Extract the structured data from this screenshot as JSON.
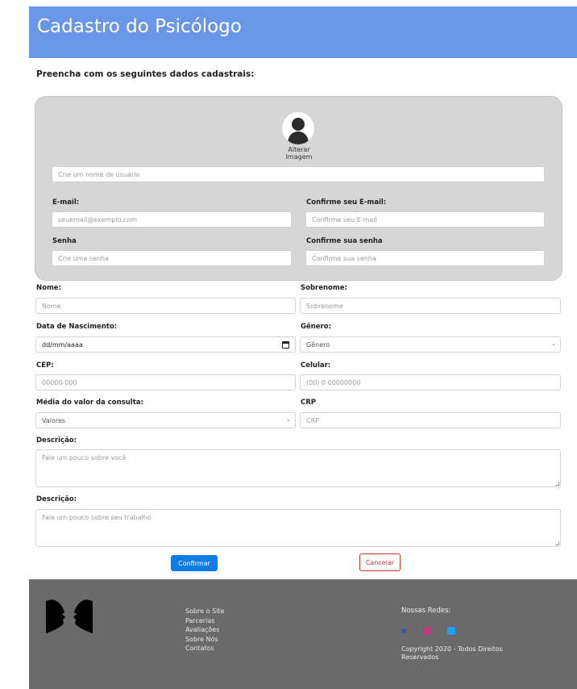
{
  "header": {
    "title": "Cadastro do Psicólogo"
  },
  "intro": "Preencha com os seguintes dados cadastrais:",
  "account": {
    "change_image_label": "Alterar Imagem",
    "username_placeholder": "Crie um nome de usuário",
    "email_label": "E-mail:",
    "email_placeholder": "seuemail@exemplo.com",
    "confirm_email_label": "Confirme seu E-mail:",
    "confirm_email_placeholder": "Confirme seu E-mail",
    "password_label": "Senha",
    "password_placeholder": "Crie uma senha",
    "confirm_password_label": "Confirme sua senha",
    "confirm_password_placeholder": "Confirme sua senha"
  },
  "form": {
    "first_name_label": "Nome:",
    "first_name_placeholder": "Nome",
    "last_name_label": "Sobrenome:",
    "last_name_placeholder": "Sobrenome",
    "birth_label": "Data de Nascimento:",
    "birth_value": "dd/mm/aaaa",
    "gender_label": "Gênero:",
    "gender_selected": "Gênero",
    "cep_label": "CEP:",
    "cep_placeholder": "00000-000",
    "phone_label": "Celular:",
    "phone_placeholder": "(00) 0 00000000",
    "price_label": "Média do valor da consulta:",
    "price_selected": "Valores",
    "crp_label": "CRP",
    "crp_placeholder": "CRP",
    "desc1_label": "Descrição:",
    "desc1_placeholder": "Fale um pouco sobre você",
    "desc2_label": "Descrição:",
    "desc2_placeholder": "Fale um pouco sobre seu trabalho"
  },
  "actions": {
    "confirm": "Confirmar",
    "cancel": "Cancelar"
  },
  "footer": {
    "links": [
      "Sobre o Site",
      "Parcerias",
      "Avaliações",
      "Sobre Nós",
      "Contatos"
    ],
    "social_title": "Nossas Redes:",
    "social_icons": [
      "facebook-icon",
      "instagram-icon",
      "twitter-icon"
    ],
    "copyright": "Copyright 2020 - Todos Direitos Reservados"
  },
  "colors": {
    "header_bg": "#6a96e8",
    "panel_bg": "#d6d6d6",
    "footer_bg": "#6a6a6a",
    "confirm_bg": "#0d7ee8",
    "cancel_border": "#c0392b",
    "facebook": "#3b5998",
    "instagram": "#c13584",
    "twitter": "#1da1f2"
  }
}
